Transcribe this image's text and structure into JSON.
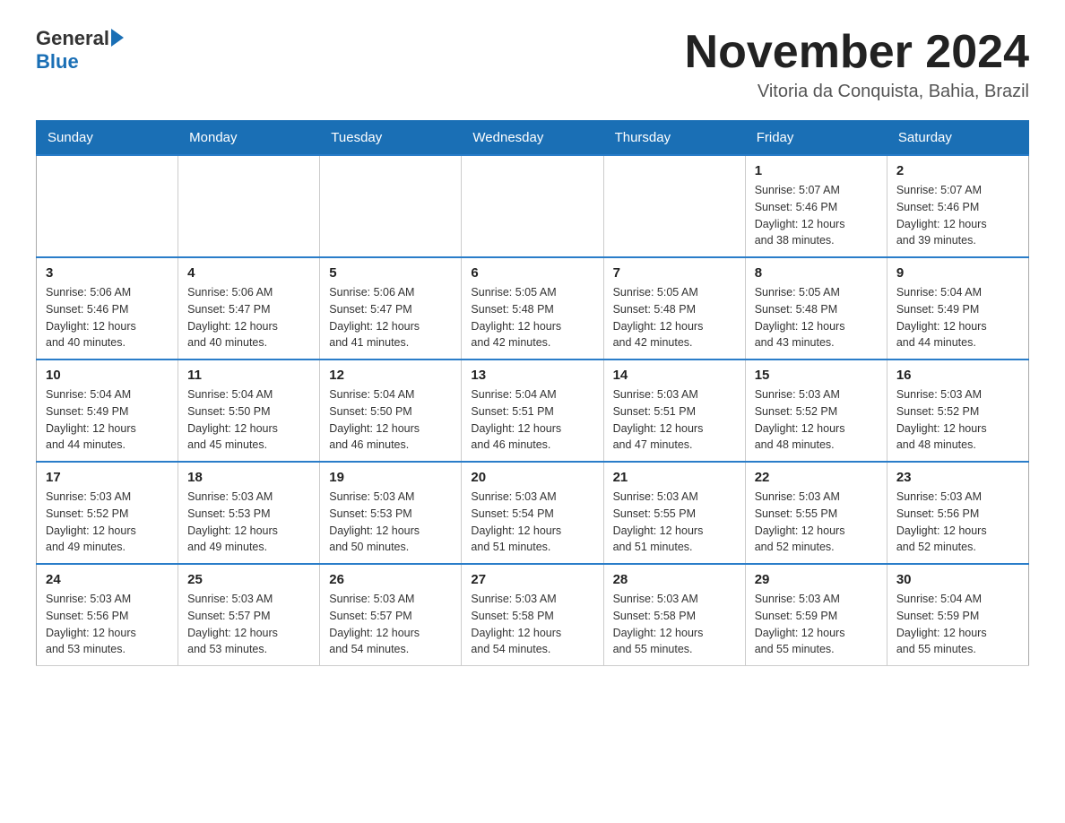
{
  "header": {
    "logo_general": "General",
    "logo_blue": "Blue",
    "month_title": "November 2024",
    "location": "Vitoria da Conquista, Bahia, Brazil"
  },
  "days_of_week": [
    "Sunday",
    "Monday",
    "Tuesday",
    "Wednesday",
    "Thursday",
    "Friday",
    "Saturday"
  ],
  "weeks": [
    [
      {
        "day": "",
        "info": ""
      },
      {
        "day": "",
        "info": ""
      },
      {
        "day": "",
        "info": ""
      },
      {
        "day": "",
        "info": ""
      },
      {
        "day": "",
        "info": ""
      },
      {
        "day": "1",
        "info": "Sunrise: 5:07 AM\nSunset: 5:46 PM\nDaylight: 12 hours\nand 38 minutes."
      },
      {
        "day": "2",
        "info": "Sunrise: 5:07 AM\nSunset: 5:46 PM\nDaylight: 12 hours\nand 39 minutes."
      }
    ],
    [
      {
        "day": "3",
        "info": "Sunrise: 5:06 AM\nSunset: 5:46 PM\nDaylight: 12 hours\nand 40 minutes."
      },
      {
        "day": "4",
        "info": "Sunrise: 5:06 AM\nSunset: 5:47 PM\nDaylight: 12 hours\nand 40 minutes."
      },
      {
        "day": "5",
        "info": "Sunrise: 5:06 AM\nSunset: 5:47 PM\nDaylight: 12 hours\nand 41 minutes."
      },
      {
        "day": "6",
        "info": "Sunrise: 5:05 AM\nSunset: 5:48 PM\nDaylight: 12 hours\nand 42 minutes."
      },
      {
        "day": "7",
        "info": "Sunrise: 5:05 AM\nSunset: 5:48 PM\nDaylight: 12 hours\nand 42 minutes."
      },
      {
        "day": "8",
        "info": "Sunrise: 5:05 AM\nSunset: 5:48 PM\nDaylight: 12 hours\nand 43 minutes."
      },
      {
        "day": "9",
        "info": "Sunrise: 5:04 AM\nSunset: 5:49 PM\nDaylight: 12 hours\nand 44 minutes."
      }
    ],
    [
      {
        "day": "10",
        "info": "Sunrise: 5:04 AM\nSunset: 5:49 PM\nDaylight: 12 hours\nand 44 minutes."
      },
      {
        "day": "11",
        "info": "Sunrise: 5:04 AM\nSunset: 5:50 PM\nDaylight: 12 hours\nand 45 minutes."
      },
      {
        "day": "12",
        "info": "Sunrise: 5:04 AM\nSunset: 5:50 PM\nDaylight: 12 hours\nand 46 minutes."
      },
      {
        "day": "13",
        "info": "Sunrise: 5:04 AM\nSunset: 5:51 PM\nDaylight: 12 hours\nand 46 minutes."
      },
      {
        "day": "14",
        "info": "Sunrise: 5:03 AM\nSunset: 5:51 PM\nDaylight: 12 hours\nand 47 minutes."
      },
      {
        "day": "15",
        "info": "Sunrise: 5:03 AM\nSunset: 5:52 PM\nDaylight: 12 hours\nand 48 minutes."
      },
      {
        "day": "16",
        "info": "Sunrise: 5:03 AM\nSunset: 5:52 PM\nDaylight: 12 hours\nand 48 minutes."
      }
    ],
    [
      {
        "day": "17",
        "info": "Sunrise: 5:03 AM\nSunset: 5:52 PM\nDaylight: 12 hours\nand 49 minutes."
      },
      {
        "day": "18",
        "info": "Sunrise: 5:03 AM\nSunset: 5:53 PM\nDaylight: 12 hours\nand 49 minutes."
      },
      {
        "day": "19",
        "info": "Sunrise: 5:03 AM\nSunset: 5:53 PM\nDaylight: 12 hours\nand 50 minutes."
      },
      {
        "day": "20",
        "info": "Sunrise: 5:03 AM\nSunset: 5:54 PM\nDaylight: 12 hours\nand 51 minutes."
      },
      {
        "day": "21",
        "info": "Sunrise: 5:03 AM\nSunset: 5:55 PM\nDaylight: 12 hours\nand 51 minutes."
      },
      {
        "day": "22",
        "info": "Sunrise: 5:03 AM\nSunset: 5:55 PM\nDaylight: 12 hours\nand 52 minutes."
      },
      {
        "day": "23",
        "info": "Sunrise: 5:03 AM\nSunset: 5:56 PM\nDaylight: 12 hours\nand 52 minutes."
      }
    ],
    [
      {
        "day": "24",
        "info": "Sunrise: 5:03 AM\nSunset: 5:56 PM\nDaylight: 12 hours\nand 53 minutes."
      },
      {
        "day": "25",
        "info": "Sunrise: 5:03 AM\nSunset: 5:57 PM\nDaylight: 12 hours\nand 53 minutes."
      },
      {
        "day": "26",
        "info": "Sunrise: 5:03 AM\nSunset: 5:57 PM\nDaylight: 12 hours\nand 54 minutes."
      },
      {
        "day": "27",
        "info": "Sunrise: 5:03 AM\nSunset: 5:58 PM\nDaylight: 12 hours\nand 54 minutes."
      },
      {
        "day": "28",
        "info": "Sunrise: 5:03 AM\nSunset: 5:58 PM\nDaylight: 12 hours\nand 55 minutes."
      },
      {
        "day": "29",
        "info": "Sunrise: 5:03 AM\nSunset: 5:59 PM\nDaylight: 12 hours\nand 55 minutes."
      },
      {
        "day": "30",
        "info": "Sunrise: 5:04 AM\nSunset: 5:59 PM\nDaylight: 12 hours\nand 55 minutes."
      }
    ]
  ]
}
